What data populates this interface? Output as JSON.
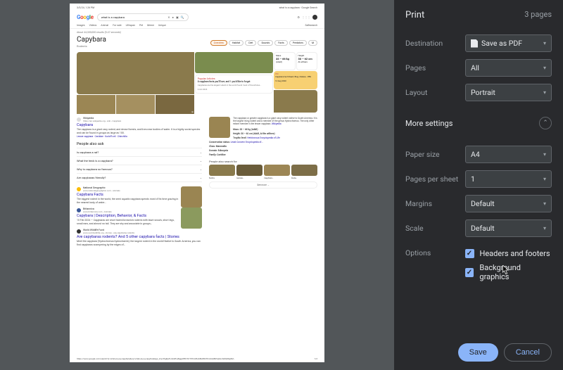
{
  "preview": {
    "timestamp": "3/5/24, 1:26 PM",
    "page_title": "what is a capybara - Google Search",
    "search_query": "what is a capybara",
    "tabs": [
      "Images",
      "Videos",
      "Animal",
      "For sale",
      "Lifespan",
      "Pet",
      "Meme",
      "Unique"
    ],
    "tools_label": "Safesearch",
    "results_info": "About 44,300,000 results (0.47 seconds)",
    "heading": "Capybara",
    "subheading": "Rodents",
    "chips": [
      "Overview",
      "Habitat",
      "Diet",
      "Sounds",
      "Facts",
      "Predators",
      "M"
    ],
    "stats": {
      "mass_label": "Mass",
      "mass_value": "35 – 66 kg",
      "mass_note": "(Adult)",
      "height_label": "Height",
      "height_value": "50 – 62 cm",
      "height_note": "At withers"
    },
    "popular": {
      "tag": "Popular Articles",
      "text": "8 capybara facts you'll love, and 1 you'd like to forget",
      "sub": "Capybaras are the largest rodent in the world found most of the articles…",
      "date": "6 Oct 2023"
    },
    "pin": {
      "tag": "PIN",
      "text": "Capybara Fact Sheet | Blog | Nature - PBS",
      "date": "14 Aug 2020"
    },
    "wiki": {
      "source": "Wikipedia",
      "url": "https://en.wikipedia.org › wiki › Capybara",
      "title": "Capybara",
      "desc": "The capybara is a giant cavy rodent, and dense forests, and lives near bodies of water. It is a highly social species and can be found in groups as large as 100.",
      "links": "Lesser capybara · Caviidae · Kurloff cell · Chinchilla"
    },
    "paa_title": "People also ask",
    "paa_items": [
      "Is capybara a rat?",
      "What the heck is a capybara?",
      "Why is capybara so famous?",
      "Are capybaras friendly?"
    ],
    "kp": {
      "desc": "The capybara or greater capybara is a giant cavy rodent native to South America. It is the largest living rodent and a member of the genus Hydrochoerus. The only other extant member is the lesser capybara.",
      "desc_source": "Wikipedia",
      "mass": "Mass: 35 – 66 kg (Adult)",
      "height": "Height: 50 – 62 cm (Adult, At the withers)",
      "trophic": "Trophic level:",
      "trophic_val": "Herbivorous",
      "trophic_src": "Encyclopedia of Life",
      "conservation": "Conservation status:",
      "conservation_val": "Least Concern",
      "conservation_src": "Encyclopedia of…",
      "class": "Class: Mammalia",
      "domain": "Domain: Eukaryota",
      "family": "Family: Caviidae"
    },
    "pasf_title": "People also search for",
    "pasf_items": [
      "Nutria",
      "Guinea…",
      "Capybara…",
      "Rode…"
    ],
    "see_more": "See more  →",
    "result2": {
      "source": "National Geographic",
      "url": "www.nationalgeographic.com › animals",
      "title": "Capybara Facts",
      "desc": "The biggest rodent in the world, the semi aquatic capybara spends most of its time grazing in the nearest body of water…"
    },
    "result3": {
      "source": "Britannica",
      "url": "www.britannica.com › Animals",
      "title": "Capybara | Description, Behavior, & Facts",
      "desc": "15 Feb 2024 — Capybaras are short haired brownish rodents with blunt snouts, short legs, small ears, and almost no tail. They are shy and associate in groups…"
    },
    "result4": {
      "source": "World Wildlife Fund",
      "url": "www.worldwildlife.org › stories › are-capybaras-rodents",
      "title": "Are capybaras rodents? And 5 other capybara facts | Stories",
      "desc": "Meet the capybara (Hydrochoerus hydrochaeris), the largest rodent in the world! Native to South America, you can find capybaras scampering by the edges of…"
    },
    "footer_url": "https://www.google.com/search?q=what+is+a+capybara&oq=what+is+a+capybara&gs_lcrp=EgZjaHJvbWUyBggAEEUYOTIHCAEQABiABDIHCAIQABiPAjIGCAMQRRg9M…",
    "footer_page": "1/3"
  },
  "panel": {
    "title": "Print",
    "page_count": "3 pages",
    "destination_label": "Destination",
    "destination_value": "Save as PDF",
    "pages_label": "Pages",
    "pages_value": "All",
    "layout_label": "Layout",
    "layout_value": "Portrait",
    "more_settings": "More settings",
    "papersize_label": "Paper size",
    "papersize_value": "A4",
    "pps_label": "Pages per sheet",
    "pps_value": "1",
    "margins_label": "Margins",
    "margins_value": "Default",
    "scale_label": "Scale",
    "scale_value": "Default",
    "options_label": "Options",
    "opt_headers": "Headers and footers",
    "opt_bg": "Background graphics",
    "save": "Save",
    "cancel": "Cancel"
  }
}
